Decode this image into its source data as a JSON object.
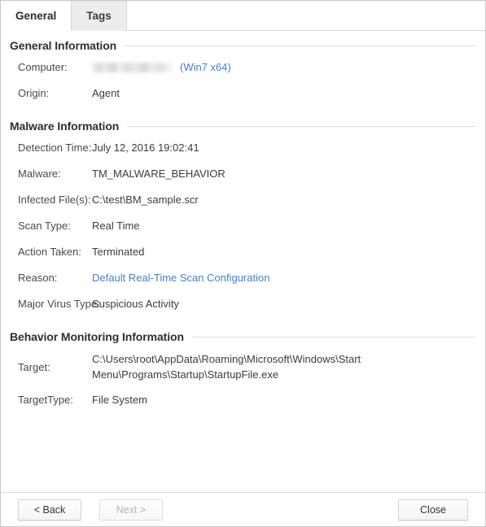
{
  "tabs": [
    {
      "label": "General",
      "active": true
    },
    {
      "label": "Tags",
      "active": false
    }
  ],
  "sections": {
    "general": {
      "title": "General Information",
      "rows": {
        "computer_label": "Computer:",
        "computer_redacted": "",
        "computer_os": "(Win7 x64)",
        "origin_label": "Origin:",
        "origin_value": "Agent"
      }
    },
    "malware": {
      "title": "Malware Information",
      "rows": {
        "detection_time_label": "Detection Time:",
        "detection_time_value": "July 12, 2016 19:02:41",
        "malware_label": "Malware:",
        "malware_value": "TM_MALWARE_BEHAVIOR",
        "infected_files_label": "Infected File(s):",
        "infected_files_value": "C:\\test\\BM_sample.scr",
        "scan_type_label": "Scan Type:",
        "scan_type_value": "Real Time",
        "action_taken_label": "Action Taken:",
        "action_taken_value": "Terminated",
        "reason_label": "Reason:",
        "reason_value": "Default Real-Time Scan Configuration",
        "major_virus_type_label": "Major Virus Type:",
        "major_virus_type_value": "Suspicious Activity"
      }
    },
    "behavior": {
      "title": "Behavior Monitoring Information",
      "rows": {
        "target_label": "Target:",
        "target_value": "C:\\Users\\root\\AppData\\Roaming\\Microsoft\\Windows\\Start Menu\\Programs\\Startup\\StartupFile.exe",
        "target_type_label": "TargetType:",
        "target_type_value": "File System"
      }
    }
  },
  "footer": {
    "back_label": "< Back",
    "next_label": "Next >",
    "close_label": "Close"
  },
  "colors": {
    "link": "#4a7fc1",
    "text": "#3c3c3c",
    "label": "#4a4a4a",
    "border": "#d5d5d5",
    "tab_inactive_bg": "#ececec"
  }
}
